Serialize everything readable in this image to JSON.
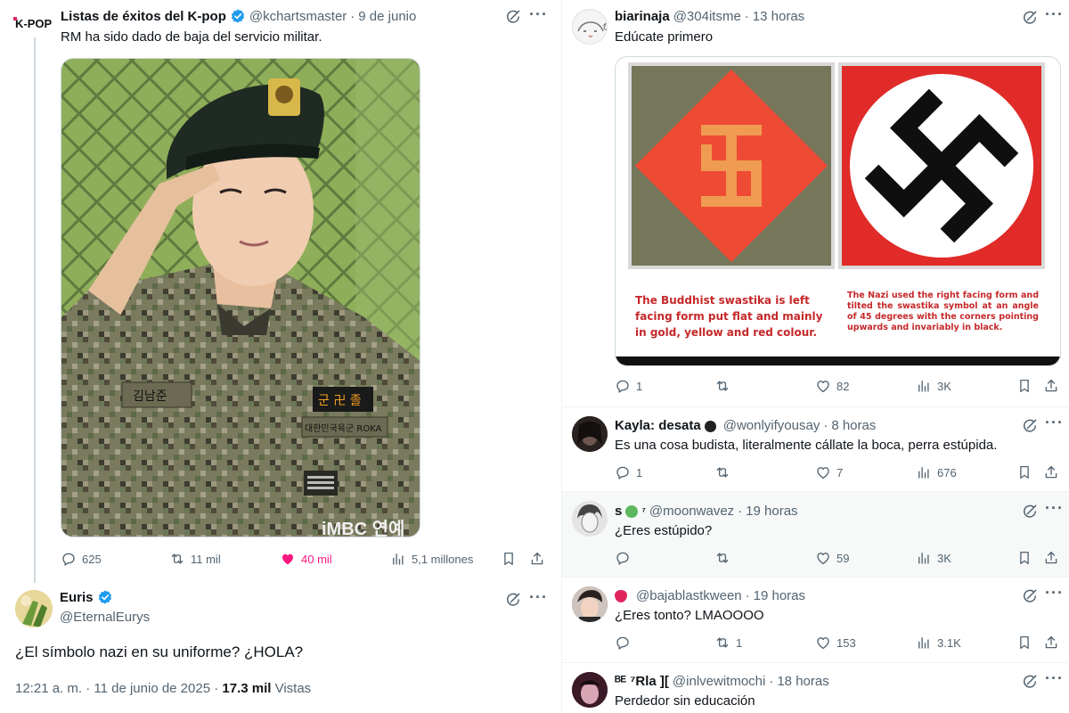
{
  "left": {
    "original_tweet": {
      "logo_text": "K-POP",
      "name": "Listas de éxitos del K-pop",
      "handle": "@kchartsmaster",
      "date": "9 de junio",
      "text": "RM ha sido dado de baja del servicio militar.",
      "image_caption_partial": "iMBC 연예",
      "patch_name": "김남준",
      "patch_unit": "대한민국육군 ROKA",
      "patch_flag": "군 卍 졸",
      "stats": {
        "replies": "625",
        "retweets": "11 mil",
        "likes": "40 mil",
        "views": "5,1 millones"
      }
    },
    "quote_tweet": {
      "name": "Euris",
      "handle": "@EternalEurys",
      "text": "¿El símbolo nazi en su uniforme? ¿HOLA?",
      "timestamp": "12:21 a. m. · 11 de junio de 2025 · ",
      "views_count": "17.3 mil",
      "views_label": " Vistas"
    }
  },
  "right": {
    "reply1": {
      "name": "biarinaja",
      "handle": "@304itsme",
      "time": "13 horas",
      "text": "Edúcate primero",
      "image": {
        "left_caption": "The Buddhist swastika is left facing form put flat and mainly in gold, yellow and red colour.",
        "right_caption": "The Nazi used the right facing form and tilted the swastika symbol at an angle of 45 degrees with the corners pointing upwards and invariably in black."
      },
      "stats": {
        "replies": "1",
        "retweets": "",
        "likes": "82",
        "views": "3K"
      }
    },
    "reply2": {
      "name": "Kayla: desata",
      "handle": "@wonlyifyousay",
      "time": "8 horas",
      "text": "Es una cosa budista, literalmente cállate la boca, perra estúpida.",
      "stats": {
        "replies": "1",
        "retweets": "",
        "likes": "7",
        "views": "676"
      }
    },
    "reply3": {
      "name": "s",
      "name_suffix": "⁷",
      "handle": "@moonwavez",
      "time": "19 horas",
      "text": "¿Eres estúpido?",
      "stats": {
        "replies": "",
        "retweets": "",
        "likes": "59",
        "views": "3K"
      }
    },
    "reply4": {
      "name": "",
      "handle": "@bajablastkween",
      "time": "19 horas",
      "text": "¿Eres tonto? LMAOOOO",
      "stats": {
        "replies": "",
        "retweets": "1",
        "likes": "153",
        "views": "3.1K"
      }
    },
    "reply5": {
      "name": "ᴮᴱ ⁷Rla ][",
      "handle": "@inlvewitmochi",
      "time": "18 horas",
      "text": "Perdedor sin educación"
    }
  },
  "colors": {
    "text": "#0f1419",
    "muted": "#536471",
    "accent": "#1d9bf0",
    "like": "#f91880",
    "divider": "#eff3f4"
  },
  "icons": [
    "reply-icon",
    "retweet-icon",
    "like-icon",
    "views-icon",
    "bookmark-icon",
    "share-icon",
    "grok-icon",
    "more-icon",
    "verified-icon"
  ]
}
